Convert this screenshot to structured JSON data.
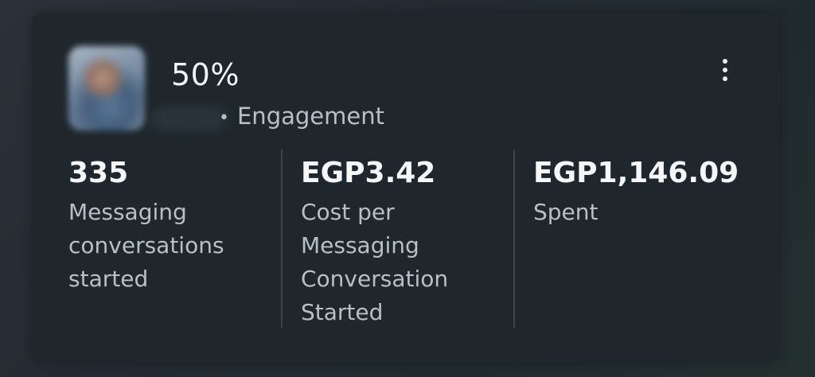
{
  "campaign": {
    "result_percent": "50%",
    "objective_separator": "•",
    "objective": "Engagement",
    "thumbnail_icon": "campaign-thumbnail",
    "menu_icon": "more-vertical-icon"
  },
  "metrics": [
    {
      "value": "335",
      "label": "Messaging conversations started"
    },
    {
      "value": "EGP3.42",
      "label": "Cost per Messaging Conversation Started"
    },
    {
      "value": "EGP1,146.09",
      "label": "Spent"
    }
  ],
  "colors": {
    "card_bg": "#1f272d",
    "primary_text": "#f4f6f8",
    "secondary_text": "#b8c0c7",
    "divider": "#3a444b"
  }
}
